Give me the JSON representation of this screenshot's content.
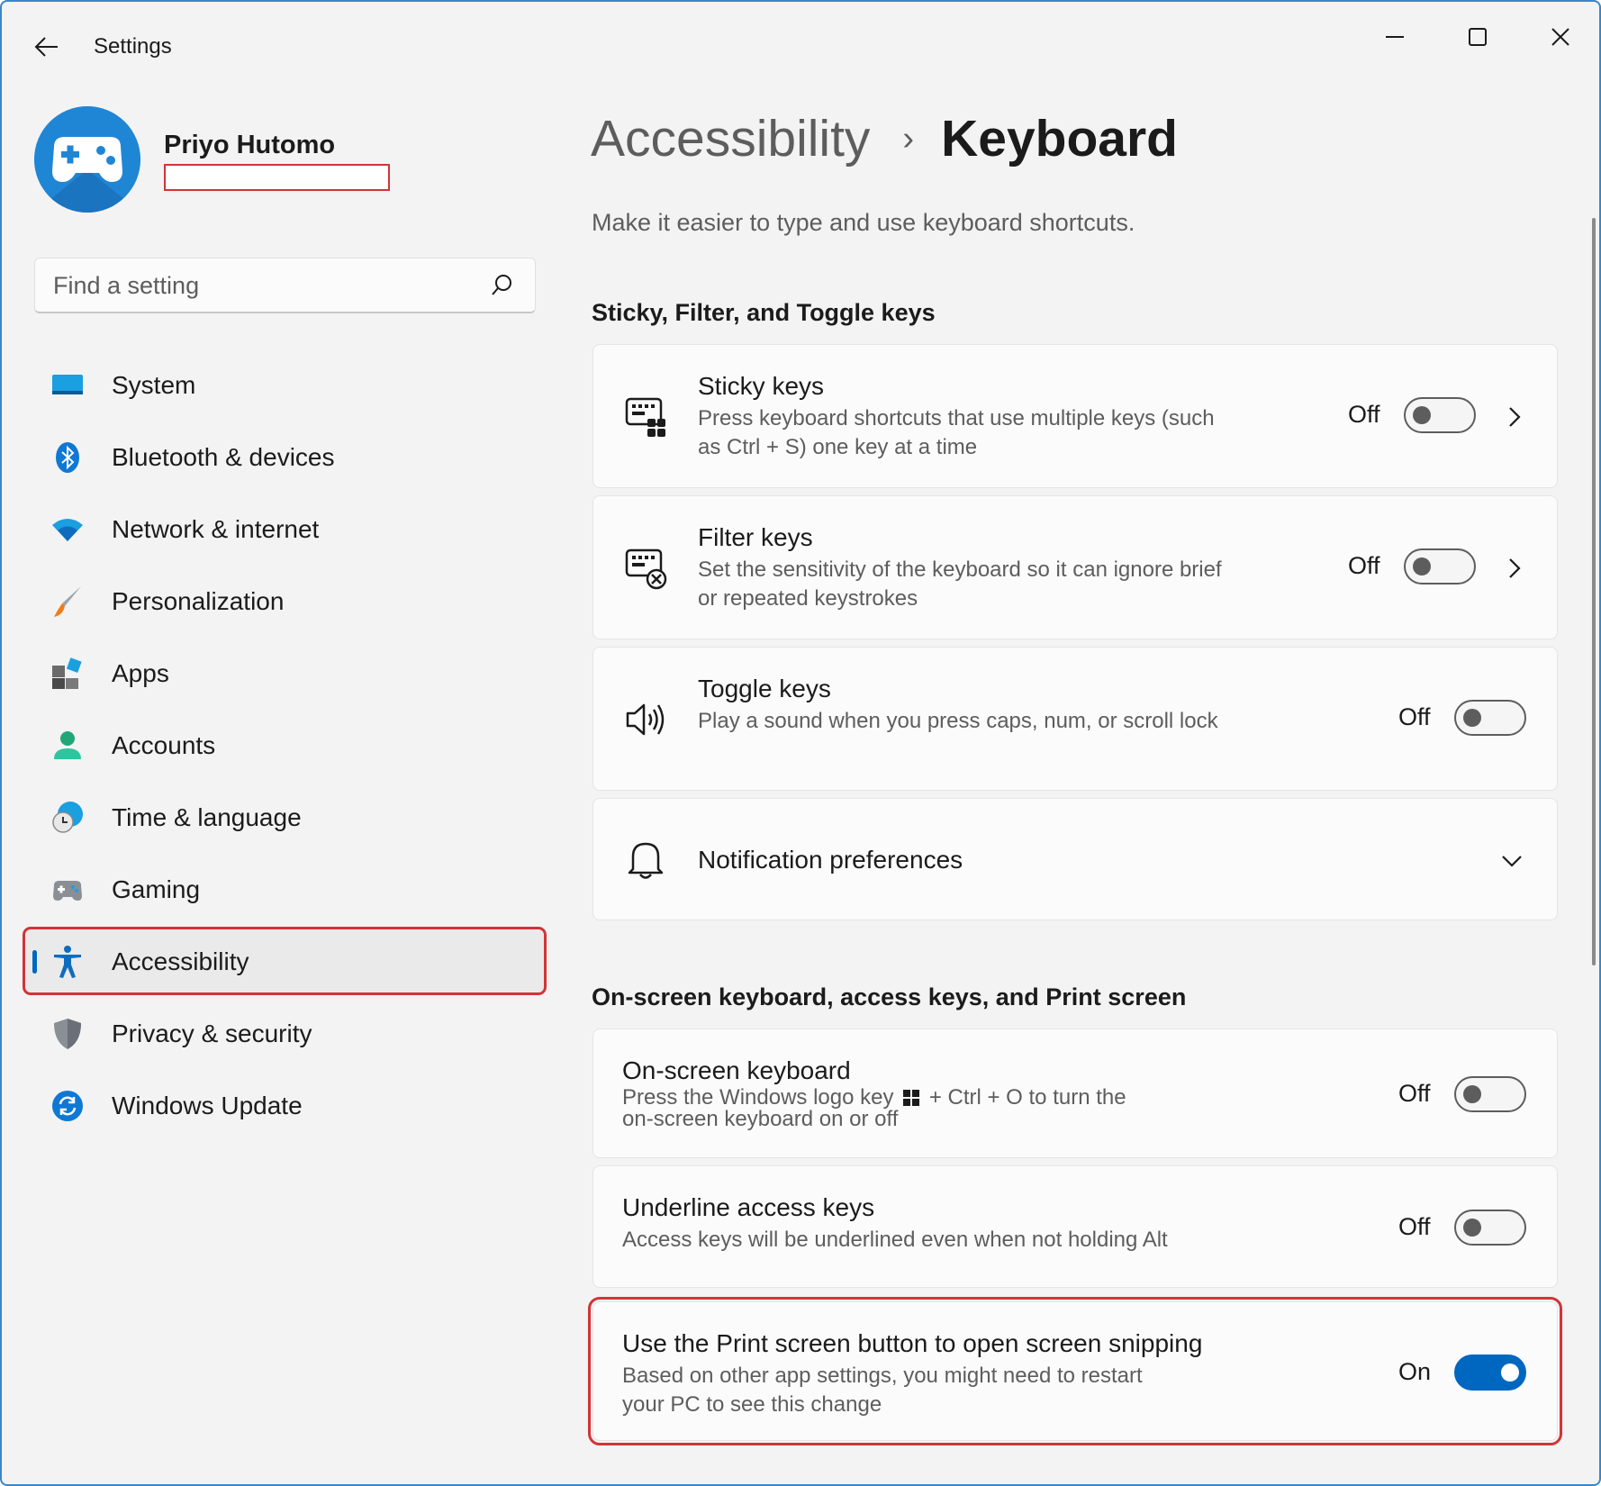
{
  "window": {
    "title": "Settings"
  },
  "profile": {
    "name": "Priyo Hutomo"
  },
  "search": {
    "placeholder": "Find a setting"
  },
  "nav": {
    "items": [
      {
        "label": "System",
        "icon": "system-icon"
      },
      {
        "label": "Bluetooth & devices",
        "icon": "bluetooth-icon"
      },
      {
        "label": "Network & internet",
        "icon": "wifi-icon"
      },
      {
        "label": "Personalization",
        "icon": "brush-icon"
      },
      {
        "label": "Apps",
        "icon": "apps-icon"
      },
      {
        "label": "Accounts",
        "icon": "person-icon"
      },
      {
        "label": "Time & language",
        "icon": "globe-clock-icon"
      },
      {
        "label": "Gaming",
        "icon": "gamepad-icon"
      },
      {
        "label": "Accessibility",
        "icon": "accessibility-icon",
        "active": true
      },
      {
        "label": "Privacy & security",
        "icon": "shield-icon"
      },
      {
        "label": "Windows Update",
        "icon": "update-icon"
      }
    ]
  },
  "content": {
    "breadcrumb_parent": "Accessibility",
    "breadcrumb_separator": "›",
    "breadcrumb_current": "Keyboard",
    "description": "Make it easier to type and use keyboard shortcuts.",
    "section1_title": "Sticky, Filter, and Toggle keys",
    "section2_title": "On-screen keyboard, access keys, and Print screen",
    "sticky": {
      "title": "Sticky keys",
      "desc": "Press keyboard shortcuts that use multiple keys (such as Ctrl + S) one key at a time",
      "state": "Off"
    },
    "filter": {
      "title": "Filter keys",
      "desc": "Set the sensitivity of the keyboard so it can ignore brief or repeated keystrokes",
      "state": "Off"
    },
    "toggle_keys": {
      "title": "Toggle keys",
      "desc": "Play a sound when you press caps, num, or scroll lock",
      "state": "Off"
    },
    "notification": {
      "title": "Notification preferences"
    },
    "onscreen": {
      "title": "On-screen keyboard",
      "desc_before": "Press the Windows logo key",
      "desc_after": "+ Ctrl + O to turn the on-screen keyboard on or off",
      "state": "Off"
    },
    "underline": {
      "title": "Underline access keys",
      "desc": "Access keys will be underlined even when not holding Alt",
      "state": "Off"
    },
    "printscreen": {
      "title": "Use the Print screen button to open screen snipping",
      "desc": "Based on other app settings, you might need to restart your PC to see this change",
      "state": "On"
    }
  },
  "colors": {
    "accent": "#0067c0",
    "highlight": "#d13438"
  }
}
